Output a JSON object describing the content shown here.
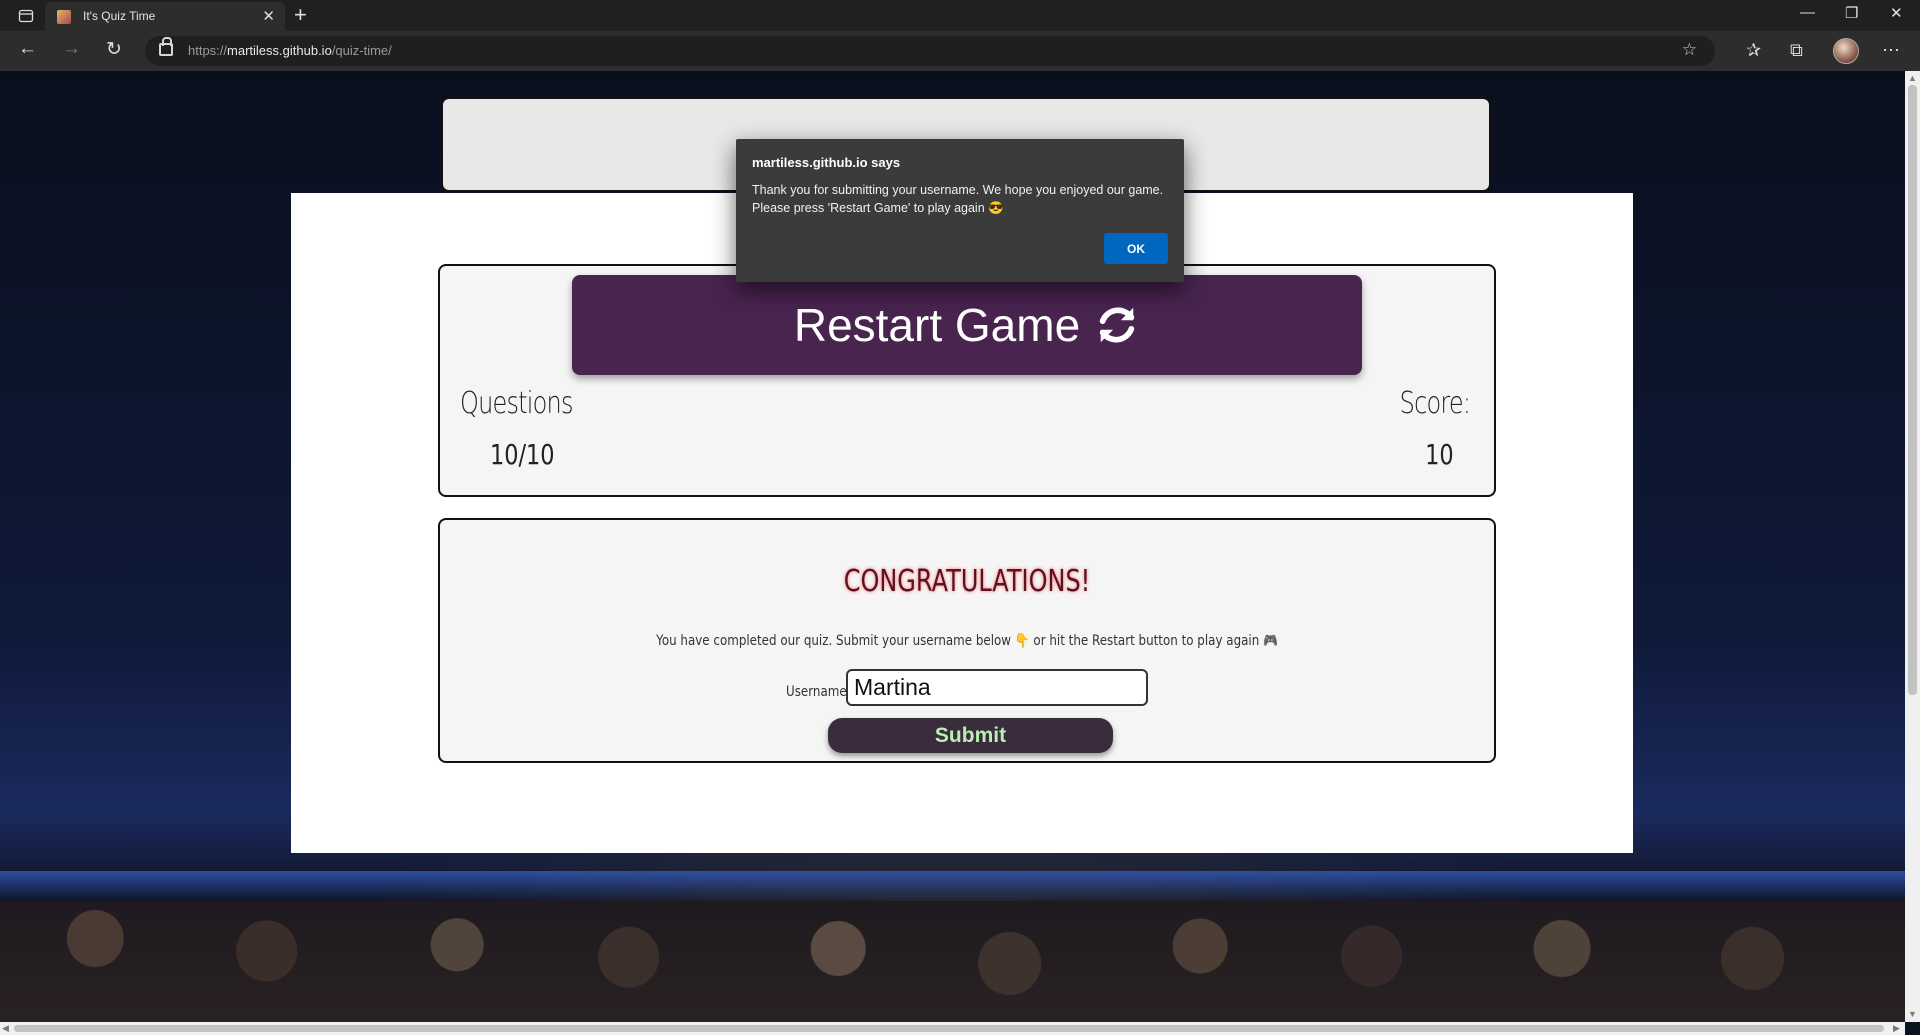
{
  "browser": {
    "tab_title": "It's Quiz Time",
    "tab_close_glyph": "✕",
    "new_tab_glyph": "+",
    "url_prefix": "https://",
    "url_host": "martiless.github.io",
    "url_path": "/quiz-time/",
    "window_controls": [
      "—",
      "❐",
      "✕"
    ]
  },
  "game": {
    "restart_label": "Restart Game",
    "questions_label": "Questions",
    "questions_value": "10/10",
    "score_label": "Score:",
    "score_value": "10",
    "congrats_title": "CONGRATULATIONS!",
    "congrats_text": "You have completed our quiz. Submit your username below 👇 or hit the Restart button to play again 🎮",
    "username_label": "Username",
    "username_value": "Martina",
    "submit_label": "Submit",
    "accent_color": "#48244f"
  },
  "dialog": {
    "title": "martiless.github.io says",
    "message": "Thank you for submitting your username. We hope you enjoyed our game. Please press 'Restart Game' to play again 😎",
    "ok_label": "OK"
  },
  "icons": [
    "tab-actions-icon",
    "back-arrow-icon",
    "forward-arrow-icon",
    "refresh-icon",
    "lock-icon",
    "favorite-add-icon",
    "favorites-icon",
    "collections-icon",
    "profile-avatar",
    "more-icon",
    "sync-icon"
  ]
}
